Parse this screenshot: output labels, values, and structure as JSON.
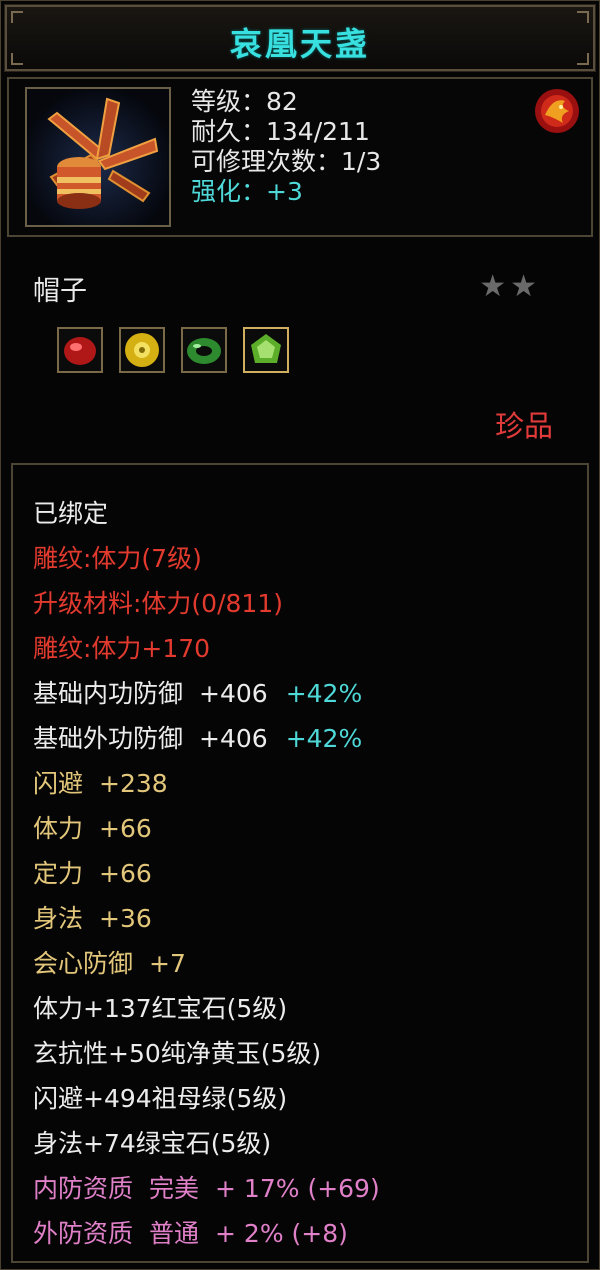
{
  "item": {
    "name": "哀凰天盏",
    "type": "帽子",
    "rarity": "珍品",
    "stars": "★★"
  },
  "stats": {
    "level": "等级：82",
    "durability": "耐久：134/211",
    "repairs": "可修理次数：1/3",
    "enhance": "强化：+3"
  },
  "gems": [
    "ruby-icon",
    "topaz-icon",
    "jade-icon",
    "emerald-icon"
  ],
  "attributes": {
    "bound": "已绑定",
    "carving": "雕纹:体力(7级)",
    "upgrade": "升级材料:体力(0/811)",
    "carving_bonus": "雕纹:体力+170",
    "inner_def": {
      "label": "基础内功防御",
      "value": "+406",
      "pct": "+42%"
    },
    "outer_def": {
      "label": "基础外功防御",
      "value": "+406",
      "pct": "+42%"
    },
    "dodge": {
      "label": "闪避",
      "value": "+238"
    },
    "stamina": {
      "label": "体力",
      "value": "+66"
    },
    "focus": {
      "label": "定力",
      "value": "+66"
    },
    "agility": {
      "label": "身法",
      "value": "+36"
    },
    "crit_def": {
      "label": "会心防御",
      "value": "+7"
    },
    "gem1": "体力+137红宝石(5级)",
    "gem2": "玄抗性+50纯净黄玉(5级)",
    "gem3": "闪避+494祖母绿(5级)",
    "gem4": "身法+74绿宝石(5级)",
    "quality_inner": {
      "label": "内防资质",
      "grade": "完美",
      "value": "+ 17% (+69)"
    },
    "quality_outer": {
      "label": "外防资质",
      "grade": "普通",
      "value": "+ 2% (+8)"
    }
  }
}
